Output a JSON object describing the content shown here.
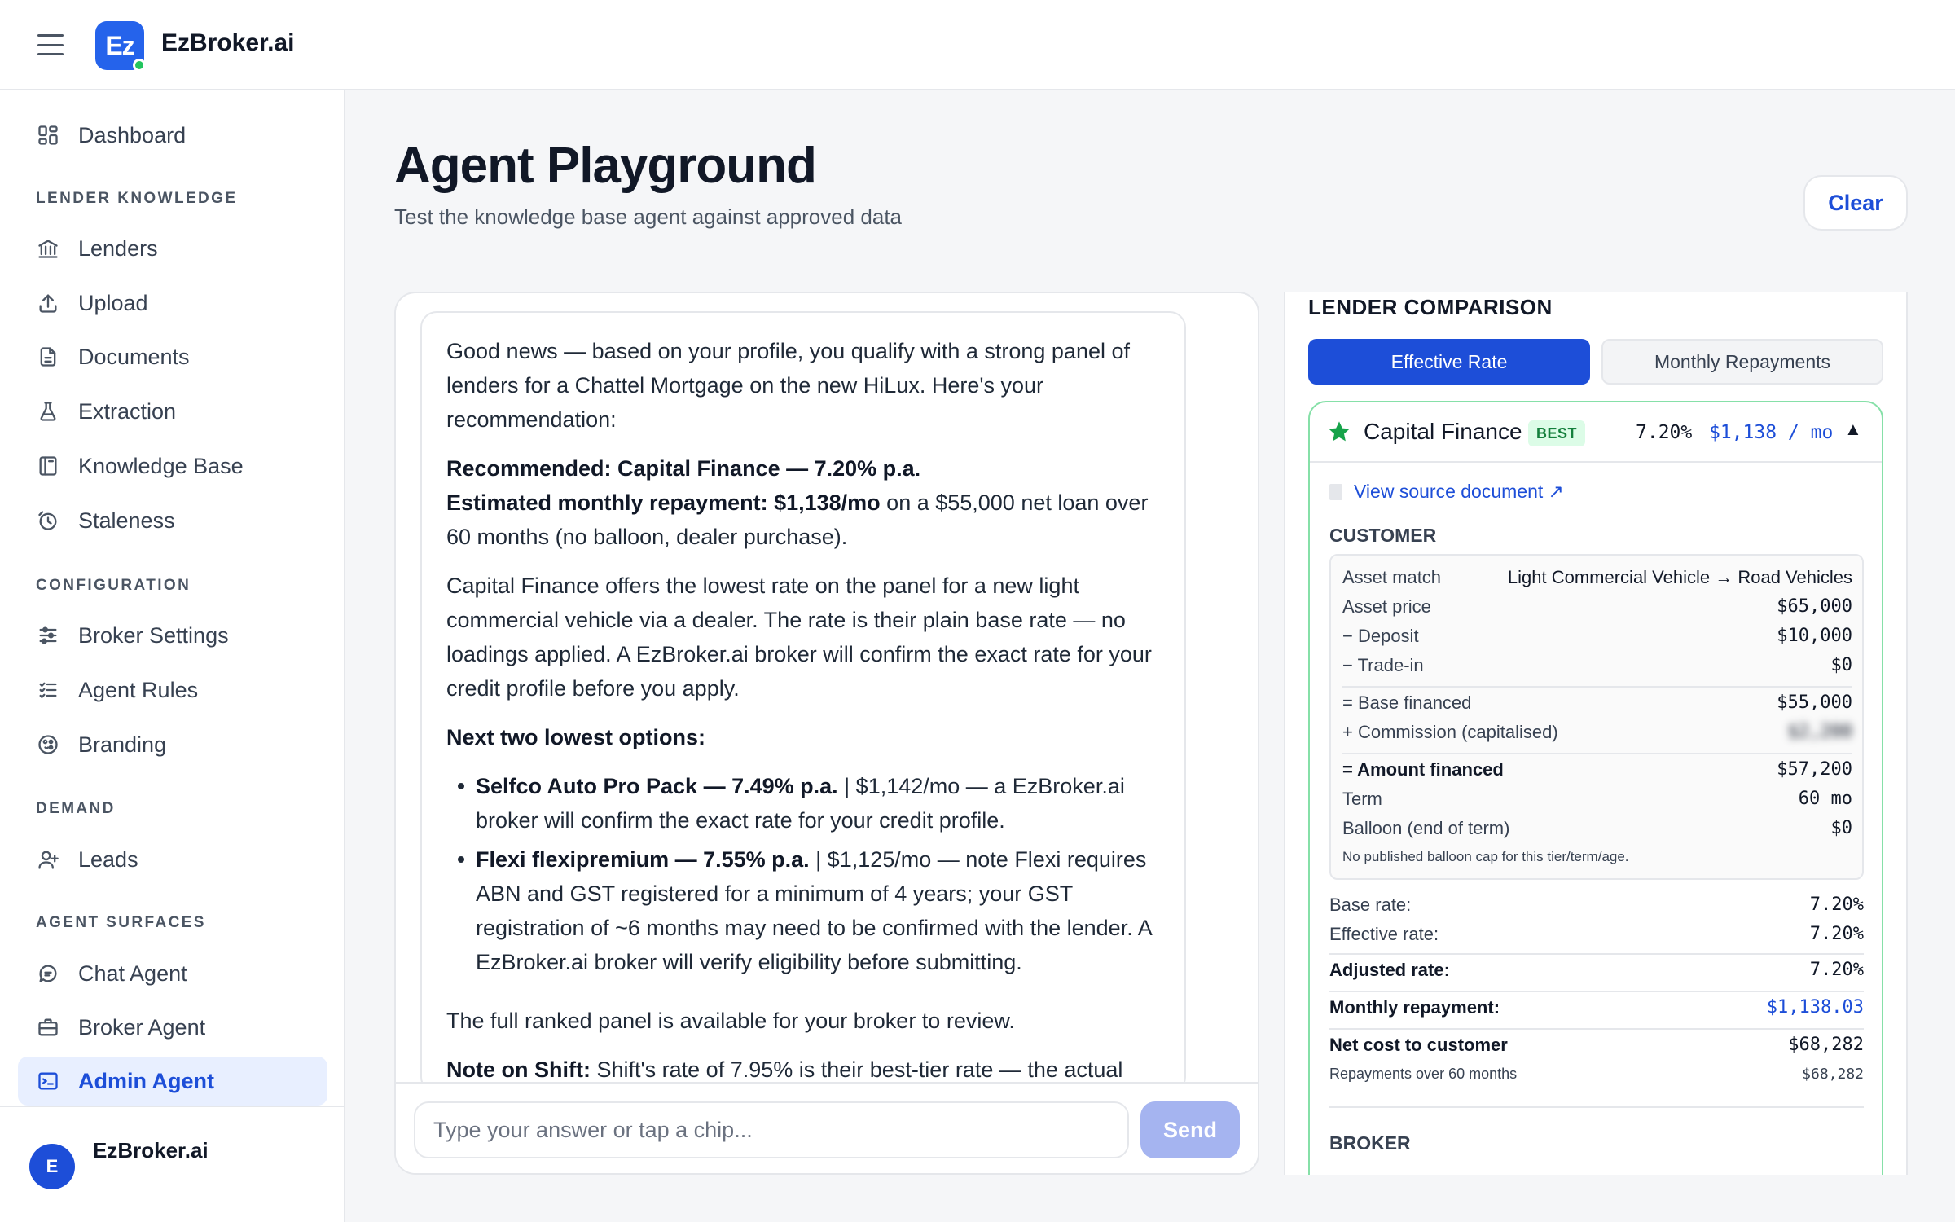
{
  "app": {
    "brand": "EzBroker.ai",
    "logo_text": "Ez"
  },
  "sidebar": {
    "dashboard": "Dashboard",
    "sections": {
      "lender_knowledge": "LENDER KNOWLEDGE",
      "configuration": "CONFIGURATION",
      "demand": "DEMAND",
      "agent_surfaces": "AGENT SURFACES"
    },
    "items": {
      "lenders": "Lenders",
      "upload": "Upload",
      "documents": "Documents",
      "extraction": "Extraction",
      "knowledge_base": "Knowledge Base",
      "staleness": "Staleness",
      "broker_settings": "Broker Settings",
      "agent_rules": "Agent Rules",
      "branding": "Branding",
      "leads": "Leads",
      "chat_agent": "Chat Agent",
      "broker_agent": "Broker Agent",
      "admin_agent": "Admin Agent"
    },
    "footer": {
      "avatar_initial": "E",
      "name": "EzBroker.ai"
    }
  },
  "page": {
    "title": "Agent Playground",
    "subtitle": "Test the knowledge base agent against approved data",
    "clear_label": "Clear"
  },
  "chat": {
    "p1": "Good news — based on your profile, you qualify with a strong panel of lenders for a Chattel Mortgage on the new HiLux. Here's your recommendation:",
    "rec_line": "Recommended: Capital Finance — 7.20% p.a.",
    "est_bold": "Estimated monthly repayment: $1,138/mo",
    "est_rest": " on a $55,000 net loan over 60 months (no balloon, dealer purchase).",
    "p3": "Capital Finance offers the lowest rate on the panel for a new light commercial vehicle via a dealer. The rate is their plain base rate — no loadings applied. A EzBroker.ai broker will confirm the exact rate for your credit profile before you apply.",
    "next_heading": "Next two lowest options:",
    "opt1_bold": "Selfco Auto Pro Pack — 7.49% p.a.",
    "opt1_rest": " | $1,142/mo — a EzBroker.ai broker will confirm the exact rate for your credit profile.",
    "opt2_bold": "Flexi flexipremium — 7.55% p.a.",
    "opt2_rest": " | $1,125/mo — note Flexi requires ABN and GST registered for a minimum of 4 years; your GST registration of ~6 months may need to be confirmed with the lender. A EzBroker.ai broker will verify eligibility before submitting.",
    "p5": "The full ranked panel is available for your broker to review.",
    "shift_bold": "Note on Shift:",
    "shift_rest": " Shift's rate of 7.95% is their best-tier rate — the actual",
    "input_placeholder": "Type your answer or tap a chip...",
    "send_label": "Send"
  },
  "comparison": {
    "title": "LENDER COMPARISON",
    "tabs": {
      "effective": "Effective Rate",
      "monthly": "Monthly Repayments"
    },
    "card": {
      "lender": "Capital Finance",
      "badge": "BEST",
      "rate": "7.20%",
      "payment": "$1,138 / mo",
      "caret": "▲",
      "source_link": "View source document ↗",
      "customer_label": "CUSTOMER",
      "asset_match_label": "Asset match",
      "asset_match_value": "Light Commercial Vehicle → Road Vehicles",
      "asset_price_label": "Asset price",
      "asset_price": "$65,000",
      "deposit_label": "− Deposit",
      "deposit": "$10,000",
      "tradein_label": "− Trade-in",
      "tradein": "$0",
      "base_financed_label": "= Base financed",
      "base_financed": "$55,000",
      "commission_label": "+ Commission (capitalised)",
      "commission": "$2,200",
      "amount_financed_label": "= Amount financed",
      "amount_financed": "$57,200",
      "term_label": "Term",
      "term": "60 mo",
      "balloon_label": "Balloon (end of term)",
      "balloon": "$0",
      "balloon_note": "No published balloon cap for this tier/term/age.",
      "base_rate_label": "Base rate:",
      "base_rate": "7.20%",
      "effective_rate_label": "Effective rate:",
      "effective_rate": "7.20%",
      "adjusted_rate_label": "Adjusted rate:",
      "adjusted_rate": "7.20%",
      "monthly_label": "Monthly repayment:",
      "monthly": "$1,138.03",
      "net_cost_label": "Net cost to customer",
      "net_cost": "$68,282",
      "repayments_label": "Repayments over 60 months",
      "repayments": "$68,282",
      "broker_label": "BROKER"
    }
  },
  "colors": {
    "accent": "#1d4ed8",
    "logo": "#2563eb",
    "best_green": "#15803d",
    "card_border": "#86e0a8"
  }
}
